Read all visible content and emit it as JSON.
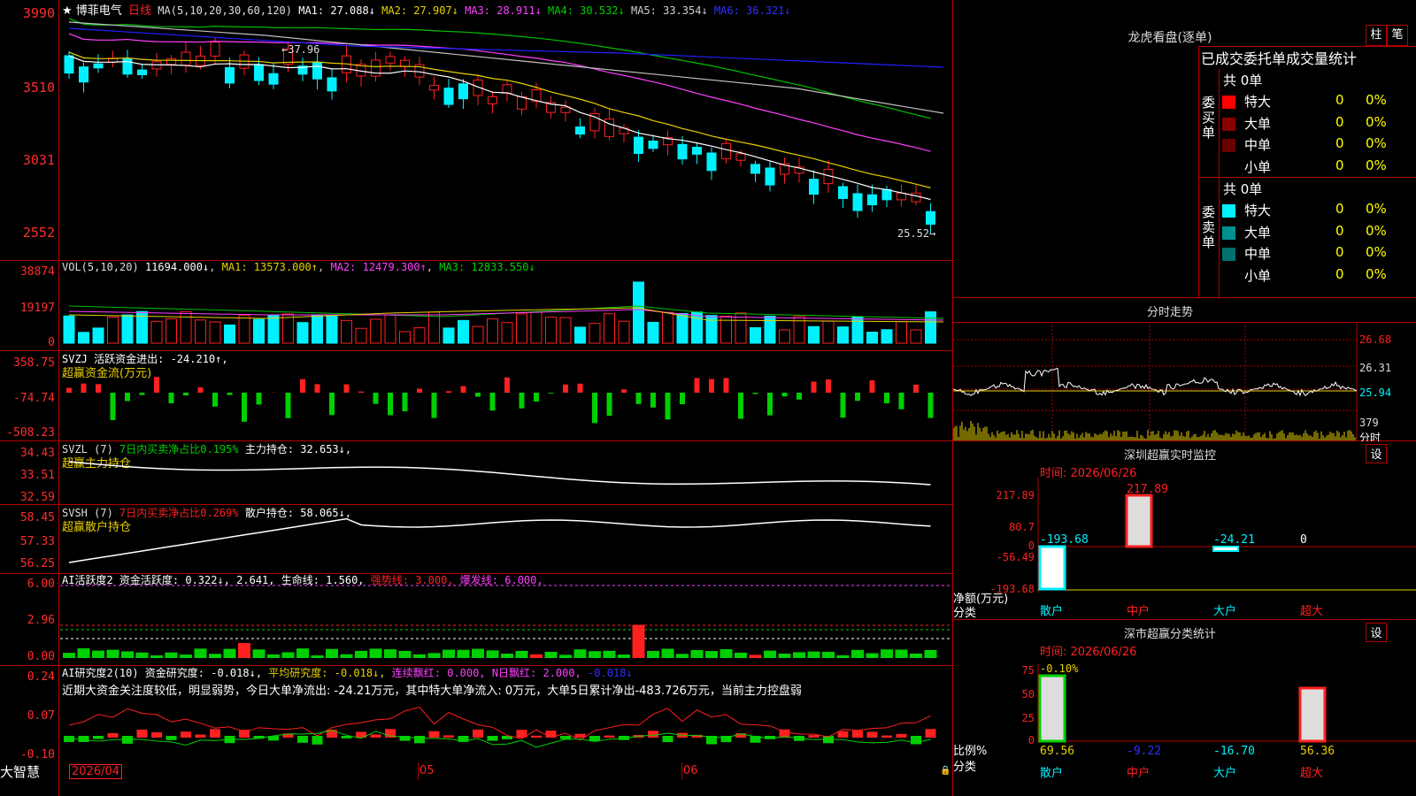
{
  "colors": {
    "up": "#ff2020",
    "down": "#00e8ff",
    "ma1": "#ffffff",
    "ma2": "#e8d000",
    "ma3": "#ff40ff",
    "ma4": "#00c000",
    "ma5": "#c0c0c0",
    "ma6": "#2020ff",
    "grid": "#b00000",
    "green": "#00e000"
  },
  "chart": {
    "title": "★ 博菲电气",
    "period": "日线",
    "ma_label": "MA(5,10,20,30,60,120)",
    "ma_values": [
      "MA1: 27.088↓",
      "MA2: 27.907↓",
      "MA3: 28.911↓",
      "MA4: 30.532↓",
      "MA5: 33.354↓",
      "MA6: 36.321↓"
    ],
    "y_ticks": [
      "3990",
      "3510",
      "3031",
      "2552"
    ],
    "price_high_label": "37.96",
    "price_low_label": "25.52",
    "dates": [
      "2026/04",
      "05",
      "06"
    ]
  },
  "vol": {
    "header": "VOL(5,10,20)",
    "value": "11694.000↓",
    "ma1": "MA1: 13573.000↑",
    "ma2": "MA2: 12479.300↑",
    "ma3": "MA3: 12833.550↓",
    "y_ticks": [
      "38874",
      "19197",
      "0"
    ]
  },
  "svzj": {
    "header": "SVZJ 活跃资金进出: -24.210↑,",
    "sub": "超赢资金流(万元)",
    "y_ticks": [
      "358.75",
      "-74.74",
      "-508.23"
    ]
  },
  "svzl": {
    "header_a": "SVZL (7)",
    "header_b": "7日内买卖净占比0.195%",
    "header_c": "主力持仓: 32.653↓,",
    "sub": "超赢主力持仓",
    "y_ticks": [
      "34.43",
      "33.51",
      "32.59"
    ]
  },
  "svsh": {
    "header_a": "SVSH (7)",
    "header_b": "7日内买卖净占比0.269%",
    "header_c": "散户持仓: 58.065↓,",
    "sub": "超赢散户持仓",
    "y_ticks": [
      "58.45",
      "57.33",
      "56.25"
    ]
  },
  "ai1": {
    "header_a": "AI活跃度2 资金活跃度: 0.322↓, 2.641, 生命线: 1.560,",
    "strong": "强势线: 3.000,",
    "burst": "爆发线: 6.000,",
    "y_ticks": [
      "6.00",
      "2.96",
      "0.00"
    ]
  },
  "ai2": {
    "header_a": "AI研究度2(10) 资金研究度: -0.018↓,",
    "avg": "平均研究度: -0.018↓,",
    "red": "连续飘红: 0.000,",
    "n": "N日飘红: 2.000,",
    "neg": "-0.018↓",
    "note": "近期大资金关注度较低，明显弱势，今日大单净流出: -24.21万元，其中特大单净流入: 0万元，大单5日累计净出-483.726万元，当前主力控盘弱",
    "y_ticks": [
      "0.24",
      "0.07",
      "-0.10"
    ]
  },
  "brand": "大智慧",
  "right": {
    "dragon": "龙虎看盘(逐单)",
    "btn_col": "柱",
    "btn_pen": "笔",
    "stats_title": "已成交委托单成交量统计",
    "buy_label": "委买单",
    "sell_label": "委卖单",
    "buy_total": "共 0单",
    "sell_total": "共 0单",
    "buy_rows": [
      [
        "特大",
        "0",
        "0%"
      ],
      [
        "大单",
        "0",
        "0%"
      ],
      [
        "中单",
        "0",
        "0%"
      ],
      [
        "小单",
        "0",
        "0%"
      ]
    ],
    "sell_rows": [
      [
        "特大",
        "0",
        "0%"
      ],
      [
        "大单",
        "0",
        "0%"
      ],
      [
        "中单",
        "0",
        "0%"
      ],
      [
        "小单",
        "0",
        "0%"
      ]
    ],
    "intraday_title": "分时走势",
    "intraday_ticks": [
      "26.68",
      "26.31",
      "25.94",
      "379",
      "分时"
    ],
    "monitor_title": "深圳超赢实时监控",
    "set": "设",
    "time_label": "时间: 2026/06/26",
    "monitor_ticks": [
      "217.89",
      "80.7",
      "0",
      "-56.49",
      "-193.68"
    ],
    "monitor_values": [
      "-193.68",
      "217.89",
      "-24.21",
      "0"
    ],
    "net_label": "净额(万元)",
    "cat_label": "分类",
    "cats": [
      "散户",
      "中户",
      "大户",
      "超大"
    ],
    "class_title": "深市超赢分类统计",
    "class_ticks": [
      "75",
      "50",
      "25",
      "0"
    ],
    "class_top": "-0.10%",
    "class_values": [
      "69.56",
      "-9.22",
      "-16.70",
      "56.36"
    ],
    "ratio_label": "比例%"
  }
}
